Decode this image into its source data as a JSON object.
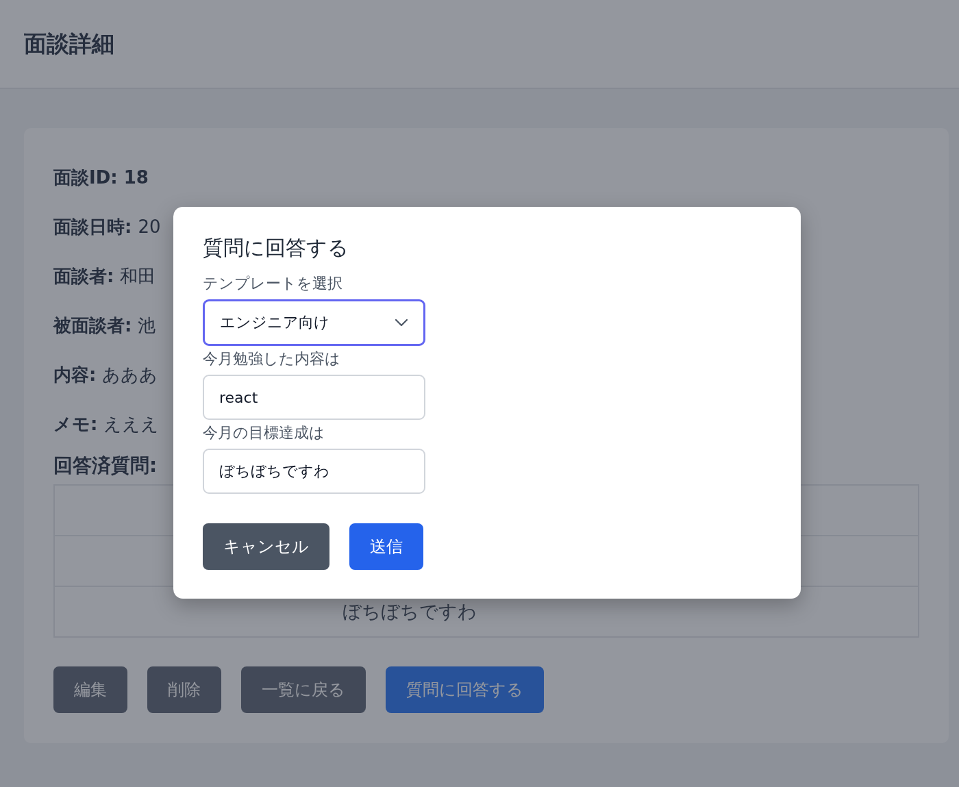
{
  "header": {
    "title": "面談詳細"
  },
  "details": [
    {
      "kind": "heading",
      "label": "面談ID: ",
      "value": "18"
    },
    {
      "kind": "field",
      "label": "面談日時: ",
      "value": "20"
    },
    {
      "kind": "field",
      "label": "面談者: ",
      "value": "和田"
    },
    {
      "kind": "field",
      "label": "被面談者: ",
      "value": "池"
    },
    {
      "kind": "field",
      "label": "内容: ",
      "value": "あああ"
    },
    {
      "kind": "field",
      "label": "メモ: ",
      "value": "えええ"
    }
  ],
  "answered_questions": {
    "label": "回答済質問:",
    "rows": [
      {
        "answer": "ぼちぼちですわ"
      }
    ]
  },
  "actions": [
    {
      "label": "編集",
      "kind": "secondary"
    },
    {
      "label": "削除",
      "kind": "secondary"
    },
    {
      "label": "一覧に戻る",
      "kind": "secondary"
    },
    {
      "label": "質問に回答する",
      "kind": "primary"
    }
  ],
  "modal": {
    "title": "質問に回答する",
    "template": {
      "label": "テンプレートを選択",
      "value": "エンジニア向け",
      "focused": true
    },
    "fields": [
      {
        "label": "今月勉強した内容は",
        "value": "react"
      },
      {
        "label": "今月の目標達成は",
        "value": "ぼちぼちですわ"
      }
    ],
    "buttons": [
      {
        "label": "キャンセル",
        "kind": "secondary"
      },
      {
        "label": "送信",
        "kind": "primary"
      }
    ]
  }
}
